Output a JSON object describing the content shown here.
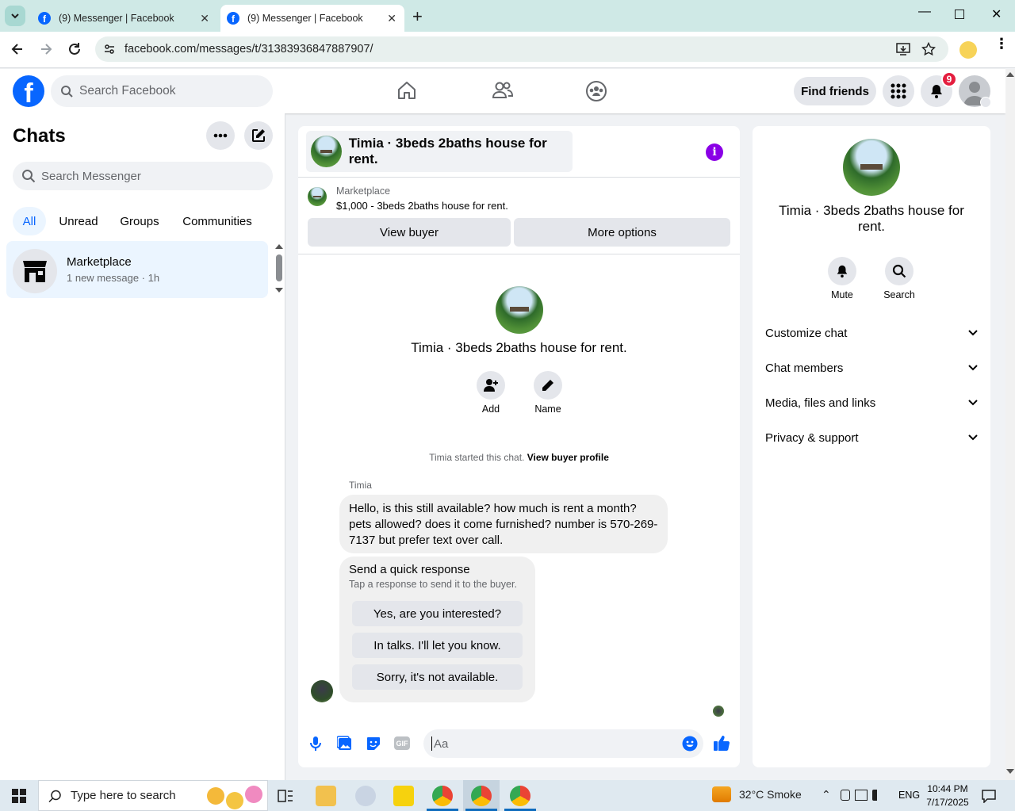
{
  "browser": {
    "tabs": [
      {
        "title": "(9) Messenger | Facebook"
      },
      {
        "title": "(9) Messenger | Facebook"
      }
    ],
    "url": "facebook.com/messages/t/31383936847887907/"
  },
  "header": {
    "search_placeholder": "Search Facebook",
    "find_friends": "Find friends",
    "notification_count": "9"
  },
  "sidebar": {
    "title": "Chats",
    "search_placeholder": "Search Messenger",
    "filters": [
      "All",
      "Unread",
      "Groups",
      "Communities"
    ],
    "chat": {
      "name": "Marketplace",
      "preview": "1 new message · 1h"
    }
  },
  "conversation": {
    "title": "Timia · 3beds 2baths house for rent.",
    "listing": {
      "label": "Marketplace",
      "price_title": "$1,000 - 3beds 2baths house for rent."
    },
    "view_buyer": "View buyer",
    "more_options": "More options",
    "intro_title": "Timia · 3beds 2baths house for rent.",
    "add_label": "Add",
    "name_label": "Name",
    "started_text": "Timia started this chat.",
    "view_profile": "View buyer profile",
    "sender": "Timia",
    "message": "Hello, is this still available? how much is rent a month? pets allowed? does it come furnished? number is 570-269-7137 but prefer text over call.",
    "quick_title": "Send a quick response",
    "quick_subtitle": "Tap a response to send it to the buyer.",
    "quick_responses": [
      "Yes, are you interested?",
      "In talks. I'll let you know.",
      "Sorry, it's not available."
    ],
    "composer_placeholder": "Aa",
    "gif_label": "GIF"
  },
  "details": {
    "title": "Timia · 3beds 2baths house for rent.",
    "mute": "Mute",
    "search": "Search",
    "sections": [
      "Customize chat",
      "Chat members",
      "Media, files and links",
      "Privacy & support"
    ]
  },
  "taskbar": {
    "search_placeholder": "Type here to search",
    "weather": "32°C  Smoke",
    "lang": "ENG",
    "time": "10:44 PM",
    "date": "7/17/2025"
  },
  "colors": {
    "brand": "#0866ff",
    "accent": "#8a00e6",
    "badge": "#e41e3f"
  }
}
